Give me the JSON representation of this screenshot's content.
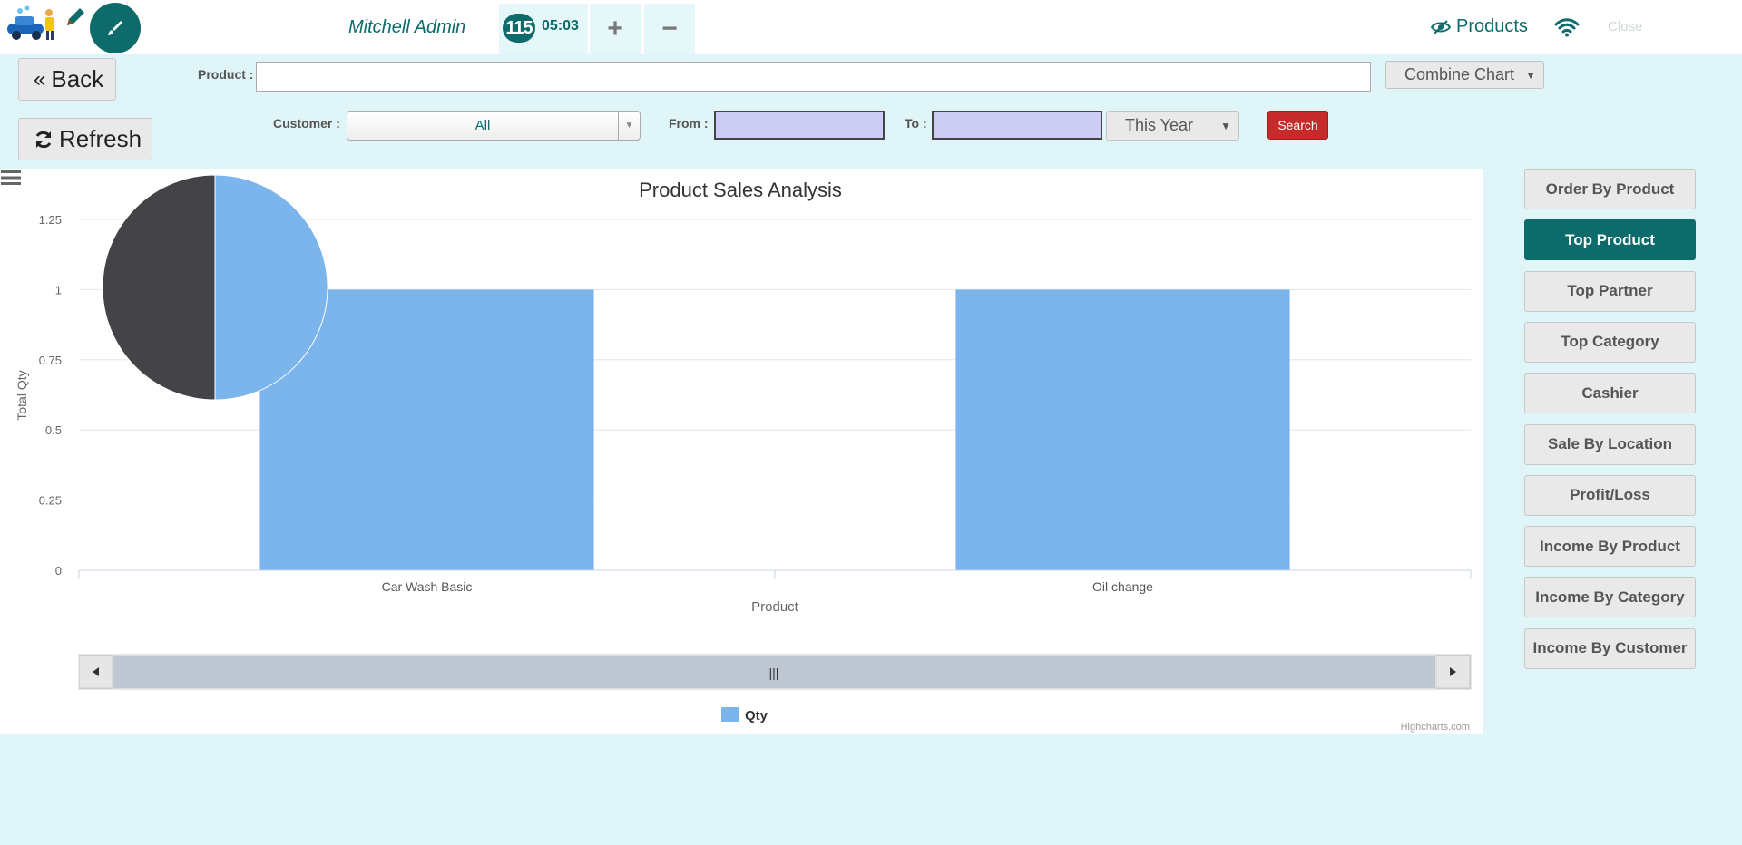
{
  "header": {
    "cashier_name": "Mitchell Admin",
    "order_number": "115",
    "order_time": "05:03",
    "add_label": "+",
    "remove_label": "−",
    "products_label": "Products",
    "close_label": "Close"
  },
  "filters": {
    "back_label": "Back",
    "refresh_label": "Refresh",
    "product_label": "Product :",
    "product_value": "",
    "chart_mode": "Combine Chart",
    "customer_label": "Customer :",
    "customer_value": "All",
    "from_label": "From :",
    "from_value": "",
    "to_label": "To :",
    "to_value": "",
    "period": "This Year",
    "search_label": "Search"
  },
  "side_menu": [
    {
      "label": "Order By Product",
      "active": false
    },
    {
      "label": "Top Product",
      "active": true
    },
    {
      "label": "Top Partner",
      "active": false
    },
    {
      "label": "Top Category",
      "active": false
    },
    {
      "label": "Cashier",
      "active": false
    },
    {
      "label": "Sale By Location",
      "active": false
    },
    {
      "label": "Profit/Loss",
      "active": false
    },
    {
      "label": "Income By Product",
      "active": false
    },
    {
      "label": "Income By Category",
      "active": false
    },
    {
      "label": "Income By Customer",
      "active": false
    }
  ],
  "chart_data": {
    "type": "bar",
    "title": "Product Sales Analysis",
    "xlabel": "Product",
    "ylabel": "Total Qty",
    "categories": [
      "Car Wash Basic",
      "Oil change"
    ],
    "series": [
      {
        "name": "Qty",
        "values": [
          1,
          1
        ],
        "color": "#7cb5ec"
      }
    ],
    "yticks": [
      "0",
      "0.25",
      "0.5",
      "0.75",
      "1",
      "1.25"
    ],
    "ylim": [
      0,
      1.25
    ],
    "grid": true,
    "legend": "bottom-center",
    "credits": "Highcharts.com",
    "pie_overlay": {
      "values": [
        1,
        1
      ],
      "colors": [
        "#7cb5ec",
        "#434348"
      ]
    },
    "colors": {
      "bar": "#7cb5ec",
      "pie_dark": "#434348",
      "grid": "#e6e6e6",
      "scrollbar": "#bfc7d3"
    }
  },
  "theme": {
    "accent": "#0d6b6b",
    "danger": "#c72a2a",
    "background": "#e0f5f8"
  }
}
